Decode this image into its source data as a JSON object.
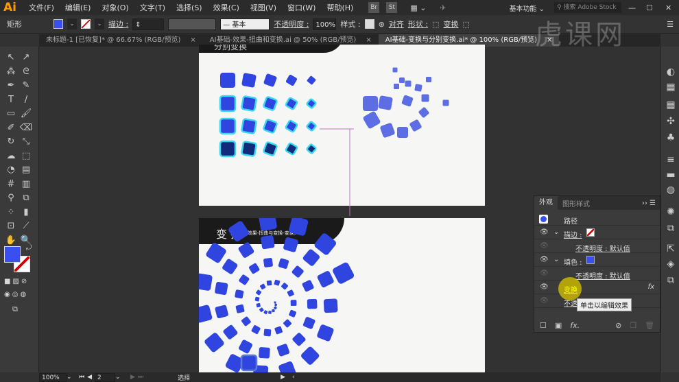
{
  "app": {
    "logo": "Ai",
    "workspace": "基本功能",
    "search_placeholder": "搜索 Adobe Stock",
    "bridge": "Br",
    "stock": "St"
  },
  "menu": [
    "文件(F)",
    "编辑(E)",
    "对象(O)",
    "文字(T)",
    "选择(S)",
    "效果(C)",
    "视图(V)",
    "窗口(W)",
    "帮助(H)"
  ],
  "control": {
    "object_type": "矩形",
    "stroke_label": "描边 :",
    "stroke_profile": "基本",
    "opacity_label": "不透明度 :",
    "opacity_value": "100%",
    "style_label": "样式 :",
    "align_label": "对齐",
    "shape_label": "形状 :",
    "transform_label": "变换",
    "fill_color": "#3a4ff0"
  },
  "tabs": [
    {
      "label": "未标题-1 [已恢复]* @ 66.67% (RGB/预览)",
      "active": false
    },
    {
      "label": "AI基础-效果-扭曲和变换.ai @ 50% (RGB/预览)",
      "active": false
    },
    {
      "label": "AI基础-变换与分别变换.ai* @ 100% (RGB/预览)",
      "active": true
    }
  ],
  "close_glyph": "×",
  "artboard1": {
    "title": "分别变换"
  },
  "artboard2": {
    "title": "变 换",
    "subtitle": "(效果-扭曲与变换-变换)"
  },
  "appearance": {
    "tab_active": "外观",
    "tab_other": "图形样式",
    "object": "路径",
    "stroke_label": "描边 :",
    "opacity1": "不透明度 : 默认值",
    "fill_label": "填色 :",
    "opacity2": "不透明度 : 默认值",
    "effect": "变换",
    "opacity3": "不透明度 : 默认值",
    "fx": "fx",
    "tooltip": "单击以编辑效果"
  },
  "status": {
    "zoom": "100%",
    "page": "2",
    "tool": "选择"
  },
  "watermark": "虎课网"
}
